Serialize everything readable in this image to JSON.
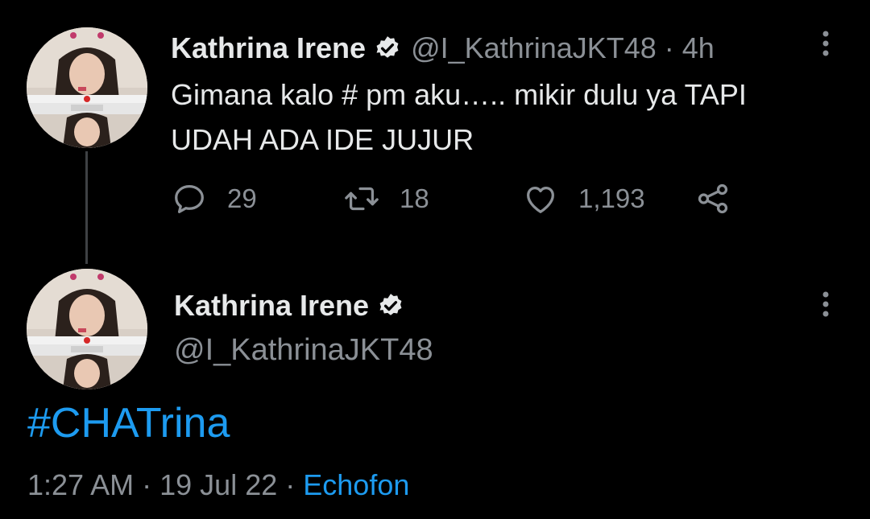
{
  "tweet1": {
    "display_name": "Kathrina Irene",
    "handle": "@I_KathrinaJKT48",
    "separator": "·",
    "time": "4h",
    "text_line1": "Gimana kalo # pm aku….. mikir dulu ya TAPI",
    "text_line2": "UDAH ADA IDE JUJUR",
    "reply_count": "29",
    "retweet_count": "18",
    "like_count": "1,193"
  },
  "tweet2": {
    "display_name": "Kathrina Irene",
    "handle": "@I_KathrinaJKT48",
    "text": "#CHATrina",
    "time": "1:27 AM",
    "sep1": "·",
    "date": "19 Jul 22",
    "sep2": "·",
    "source": "Echofon"
  },
  "icons": {
    "verified": "verified-badge-icon",
    "more": "more-vertical-icon",
    "reply": "reply-icon",
    "retweet": "retweet-icon",
    "like": "heart-icon",
    "share": "share-icon"
  },
  "colors": {
    "background": "#000000",
    "text_primary": "#e7e9ea",
    "text_secondary": "#8b9096",
    "link": "#1d9bf0"
  }
}
